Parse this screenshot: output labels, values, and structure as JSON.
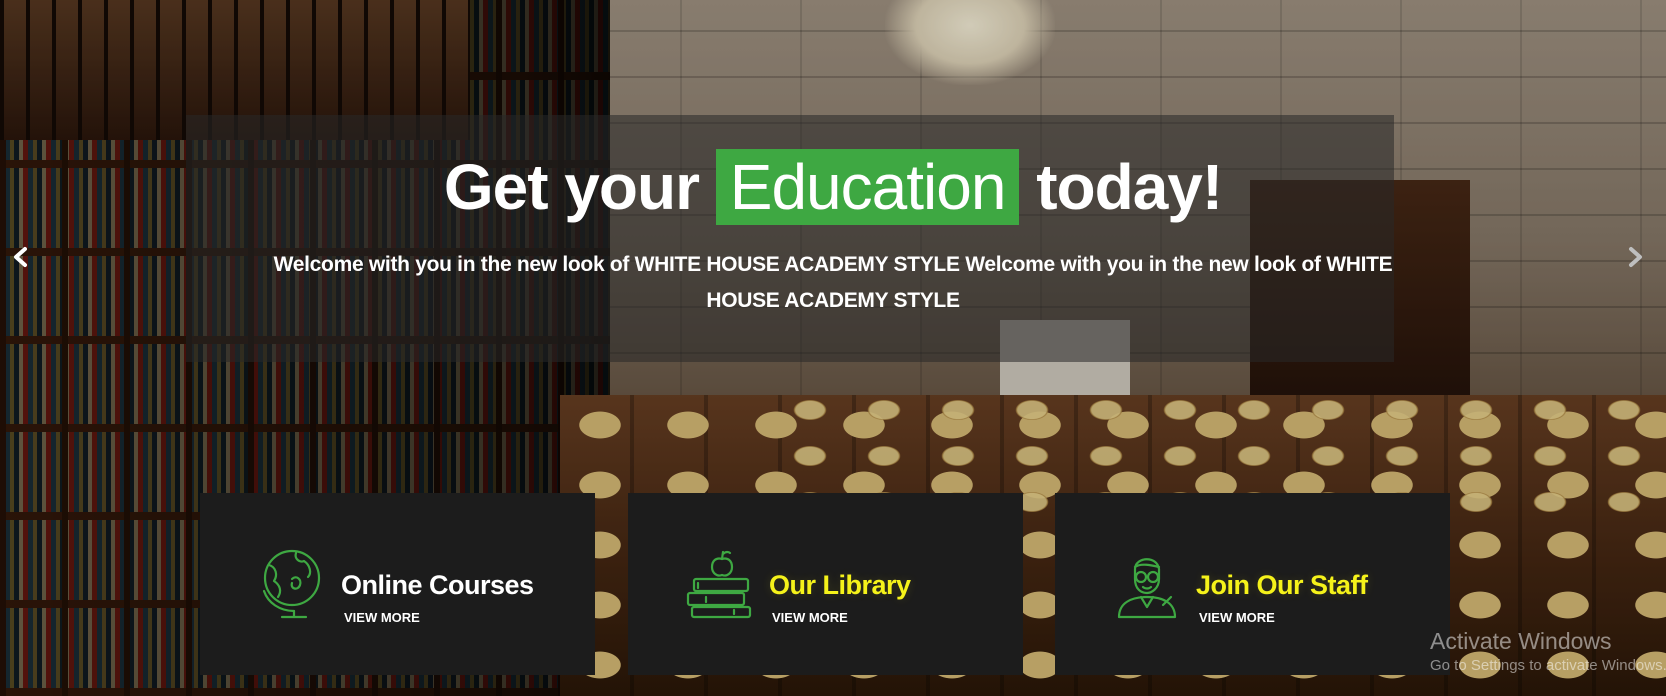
{
  "hero": {
    "title_before": "Get your ",
    "title_highlight": "Education",
    "title_after": " today!",
    "subtitle": "Welcome with you in the new look of WHITE HOUSE ACADEMY STYLE Welcome with you in the new look of WHITE HOUSE ACADEMY STYLE",
    "highlight_color": "#3ea842"
  },
  "carousel": {
    "prev_icon": "chevron-left-icon",
    "next_icon": "chevron-right-icon"
  },
  "cards": [
    {
      "title": "Online Courses",
      "link": "VIEW MORE",
      "icon": "globe-icon",
      "title_color": "#ffffff"
    },
    {
      "title": "Our Library",
      "link": "VIEW MORE",
      "icon": "books-apple-icon",
      "title_color": "#f5f21a"
    },
    {
      "title": "Join Our Staff",
      "link": "VIEW MORE",
      "icon": "teacher-icon",
      "title_color": "#f5f21a"
    }
  ],
  "colors": {
    "card_background": "#1c1c1c",
    "icon_green": "#3ea842",
    "accent_yellow": "#f5f21a"
  },
  "watermark": {
    "title": "Activate Windows",
    "subtitle": "Go to Settings to activate Windows."
  }
}
